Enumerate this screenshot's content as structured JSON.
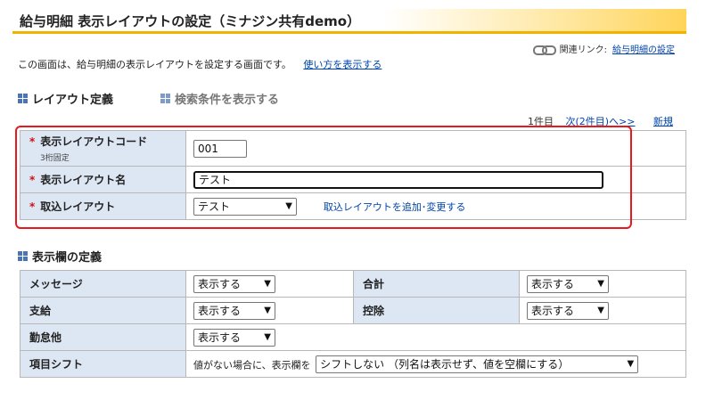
{
  "header": {
    "title": "給与明細 表示レイアウトの設定（ミナジン共有demo）"
  },
  "related": {
    "prefix": "関連リンク:",
    "link_label": "給与明細の設定"
  },
  "intro": {
    "text": "この画面は、給与明細の表示レイアウトを設定する画面です。",
    "help_link": "使い方を表示する"
  },
  "layout_section": {
    "title": "レイアウト定義",
    "search_toggle": "検索条件を表示する"
  },
  "paging": {
    "count": "1件目",
    "next": "次(2件目)へ>>",
    "new": "新規"
  },
  "layout_form": {
    "code_label": "表示レイアウトコード",
    "code_sub": "3桁固定",
    "code_value": "001",
    "name_label": "表示レイアウト名",
    "name_value": "テスト",
    "import_label": "取込レイアウト",
    "import_value": "テスト",
    "import_link": "取込レイアウトを追加･変更する"
  },
  "display_section": {
    "title": "表示欄の定義"
  },
  "display_form": {
    "message_label": "メッセージ",
    "message_value": "表示する",
    "total_label": "合計",
    "total_value": "表示する",
    "payment_label": "支給",
    "payment_value": "表示する",
    "deduction_label": "控除",
    "deduction_value": "表示する",
    "attendance_label": "勤怠他",
    "attendance_value": "表示する",
    "shift_label": "項目シフト",
    "shift_prefix": "値がない場合に、表示欄を",
    "shift_value": "シフトしない （列名は表示せず、値を空欄にする）"
  },
  "colors": {
    "accent": "#f0b400",
    "label_bg": "#dde6f3",
    "highlight": "#e8191c",
    "link": "#0044aa"
  }
}
